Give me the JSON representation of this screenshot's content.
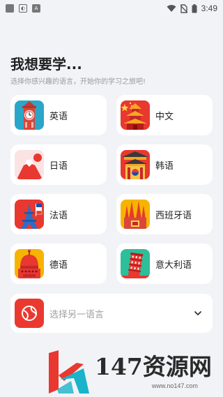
{
  "status_bar": {
    "time": "3:49",
    "left_icons": [
      "app-square-icon",
      "shield-icon",
      "a-letter-icon"
    ],
    "right_icons": [
      "wifi-icon",
      "no-sim-icon",
      "battery-icon"
    ]
  },
  "header": {
    "title": "我想要学...",
    "subtitle": "选择你感兴趣的语言，开始你的学习之旅吧!"
  },
  "languages": [
    {
      "label": "英语",
      "icon": "big-ben-icon",
      "color": "#2aa6c9"
    },
    {
      "label": "中文",
      "icon": "pagoda-icon",
      "color": "#e8382f"
    },
    {
      "label": "日语",
      "icon": "mount-fuji-icon",
      "color": "#fbe3e3"
    },
    {
      "label": "韩语",
      "icon": "korean-gate-icon",
      "color": "#e8382f"
    },
    {
      "label": "法语",
      "icon": "eiffel-tower-icon",
      "color": "#e8382f"
    },
    {
      "label": "西班牙语",
      "icon": "sagrada-familia-icon",
      "color": "#f6b400"
    },
    {
      "label": "德语",
      "icon": "german-helmet-icon",
      "color": "#f6b400"
    },
    {
      "label": "意大利语",
      "icon": "leaning-tower-icon",
      "color": "#2dbf9a"
    }
  ],
  "other": {
    "label": "选择另一语言",
    "icon": "globe-icon",
    "color": "#ea3a30"
  },
  "watermark": {
    "title": "147资源网",
    "url": "www.no147.com"
  }
}
